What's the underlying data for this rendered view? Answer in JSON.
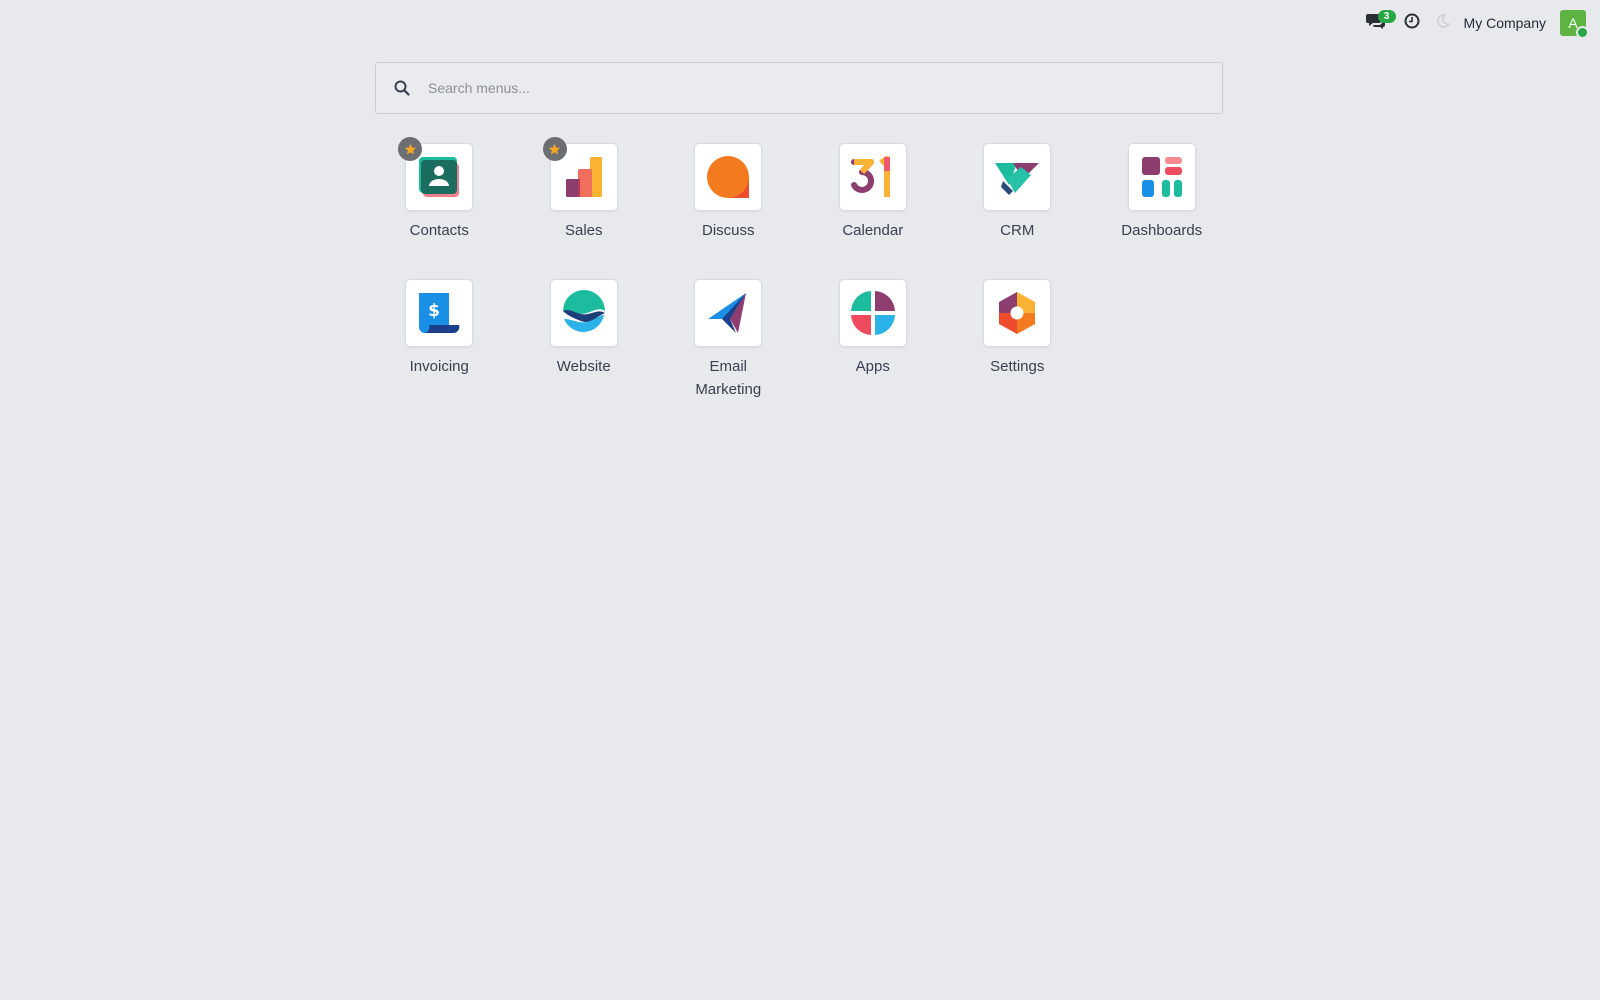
{
  "topbar": {
    "chat_count": "3",
    "company": "My Company",
    "avatar_letter": "A"
  },
  "search": {
    "placeholder": "Search menus..."
  },
  "apps": [
    {
      "label": "Contacts",
      "icon": "contacts-icon",
      "favorite": true
    },
    {
      "label": "Sales",
      "icon": "sales-icon",
      "favorite": true
    },
    {
      "label": "Discuss",
      "icon": "discuss-icon",
      "favorite": false
    },
    {
      "label": "Calendar",
      "icon": "calendar-icon",
      "favorite": false
    },
    {
      "label": "CRM",
      "icon": "crm-icon",
      "favorite": false
    },
    {
      "label": "Dashboards",
      "icon": "dashboards-icon",
      "favorite": false
    },
    {
      "label": "Invoicing",
      "icon": "invoicing-icon",
      "favorite": false
    },
    {
      "label": "Website",
      "icon": "website-icon",
      "favorite": false
    },
    {
      "label": "Email Marketing",
      "icon": "email-marketing-icon",
      "favorite": false
    },
    {
      "label": "Apps",
      "icon": "apps-icon",
      "favorite": false
    },
    {
      "label": "Settings",
      "icon": "settings-icon",
      "favorite": false
    }
  ],
  "colors": {
    "background": "#e7e9ed",
    "badge": "#28a745",
    "avatar": "#5fb343",
    "star": "#f3a823"
  }
}
